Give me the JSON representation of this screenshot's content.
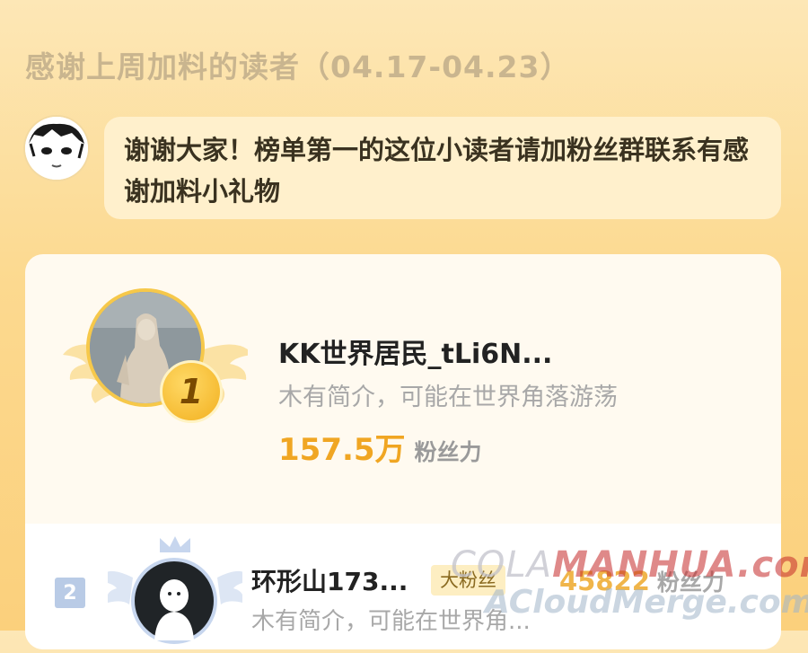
{
  "header": {
    "title": "感谢上周加料的读者（04.17-04.23）"
  },
  "author_message": {
    "text": "谢谢大家！榜单第一的这位小读者请加粉丝群联系有感谢加料小礼物"
  },
  "ranking": [
    {
      "rank": "1",
      "name": "KK世界居民_tLi6N...",
      "bio": "木有简介，可能在世界角落游荡",
      "power_value": "157.5万",
      "power_label": "粉丝力"
    },
    {
      "rank": "2",
      "name": "环形山173...",
      "tag": "大粉丝",
      "bio": "木有简介，可能在世界角...",
      "power_value": "45822",
      "power_label": "粉丝力"
    }
  ],
  "watermark": {
    "line1_prefix": "COLA",
    "line1_main": "MANHUA.com",
    "line2": "ACloudMerge.com"
  },
  "colors": {
    "accent_gold": "#f0a623",
    "rank2_blue": "#b9cbe6"
  }
}
